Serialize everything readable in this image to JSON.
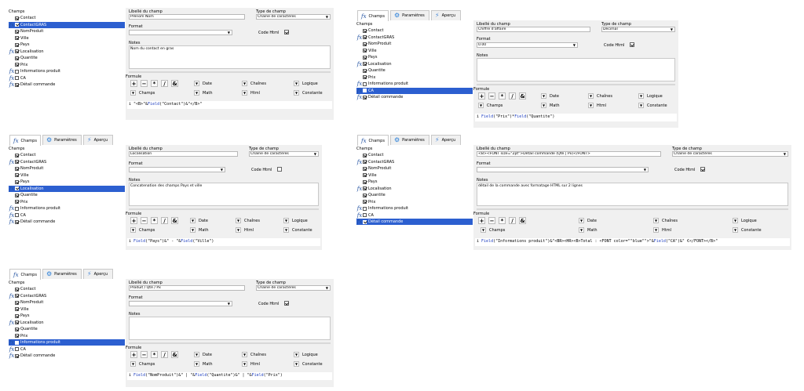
{
  "tabs": {
    "champs": "Champs",
    "parametres": "Paramètres",
    "apercu": "Aperçu"
  },
  "labels": {
    "fields_title": "Champs",
    "libelle": "Libellé du champ",
    "type": "Type de champ",
    "format": "Format",
    "code_html": "Code Html",
    "notes": "Notes",
    "formule": "Formule"
  },
  "operators": [
    "+",
    "−",
    "*",
    "/",
    "&"
  ],
  "dropdowns": [
    "Date",
    "Chaînes",
    "Logique",
    "Champs",
    "Math",
    "Html",
    "Constante"
  ],
  "fields": [
    {
      "name": "Contact",
      "checked": true,
      "fx": false
    },
    {
      "name": "ContactGRAS",
      "checked": true,
      "fx": true
    },
    {
      "name": "NomProduit",
      "checked": true,
      "fx": false
    },
    {
      "name": "Ville",
      "checked": true,
      "fx": false
    },
    {
      "name": "Pays",
      "checked": true,
      "fx": false
    },
    {
      "name": "Localisation",
      "checked": true,
      "fx": true
    },
    {
      "name": "Quantite",
      "checked": true,
      "fx": false
    },
    {
      "name": "Prix",
      "checked": true,
      "fx": false
    },
    {
      "name": "Informations produit",
      "checked": false,
      "fx": true
    },
    {
      "name": "CA",
      "checked": false,
      "fx": true
    },
    {
      "name": "Détail commande",
      "checked": true,
      "fx": true
    }
  ],
  "panels": [
    {
      "id": "p1",
      "selected": 1,
      "show_tabs": false,
      "libelle": "Prénom Nom",
      "type": "Chaîne de caractères",
      "format": "",
      "code_html": true,
      "notes": "Nom du contact en gras",
      "formula": [
        [
          "i ",
          "n"
        ],
        [
          "\"<B>\"&",
          "n"
        ],
        [
          "Field",
          "k"
        ],
        [
          "(\"Contact\")&\"</B>\"",
          "n"
        ]
      ]
    },
    {
      "id": "p2",
      "selected": 9,
      "show_tabs": true,
      "libelle": "Chiffre d'affaire",
      "type": "Décimal",
      "format": "0.00",
      "code_html": true,
      "notes": "",
      "formula": [
        [
          "i ",
          "n"
        ],
        [
          "Field",
          "k"
        ],
        [
          "(\"Prix\")*",
          "n"
        ],
        [
          "Field",
          "k"
        ],
        [
          "(\"Quantite\")",
          "n"
        ]
      ]
    },
    {
      "id": "p3",
      "selected": 5,
      "show_tabs": true,
      "libelle": "Localisation",
      "type": "Chaîne de caractères",
      "format": "",
      "code_html": false,
      "notes": "Concatenation des champs Pays et ville",
      "formula": [
        [
          "i ",
          "n"
        ],
        [
          "Field",
          "k"
        ],
        [
          "(\"Pays\")&\" - \"&",
          "n"
        ],
        [
          "Field",
          "k"
        ],
        [
          "(\"Ville\")",
          "n"
        ]
      ]
    },
    {
      "id": "p4",
      "selected": 10,
      "show_tabs": true,
      "libelle": "<B><FONT size=\"2pt\">Détail commande (Qté | Px)</FONT>",
      "type": "Chaîne de caractères",
      "format": "",
      "code_html": true,
      "notes": "détail de la commande avec formatage HTML sur 2 lignes",
      "formula": [
        [
          "i ",
          "n"
        ],
        [
          "Field",
          "k"
        ],
        [
          "(\"Informations produit\")&\"<BR><HR><B>Total : <FONT color=\"\"blue\"\">\"&",
          "n"
        ],
        [
          "Field",
          "k"
        ],
        [
          "(\"CA\")&\" €</FONT></B>\"",
          "n"
        ]
      ]
    },
    {
      "id": "p5",
      "selected": 8,
      "show_tabs": true,
      "libelle": "Produit / Qté / Px",
      "type": "Chaîne de caractères",
      "format": "",
      "code_html": true,
      "notes": "",
      "formula": [
        [
          "i ",
          "n"
        ],
        [
          "Field",
          "k"
        ],
        [
          "(\"NomProduit\")&\" | \"&",
          "n"
        ],
        [
          "Field",
          "k"
        ],
        [
          "(\"Quantite\")&\" | \"&",
          "n"
        ],
        [
          "Field",
          "k"
        ],
        [
          "(\"Prix\")",
          "n"
        ]
      ]
    }
  ]
}
